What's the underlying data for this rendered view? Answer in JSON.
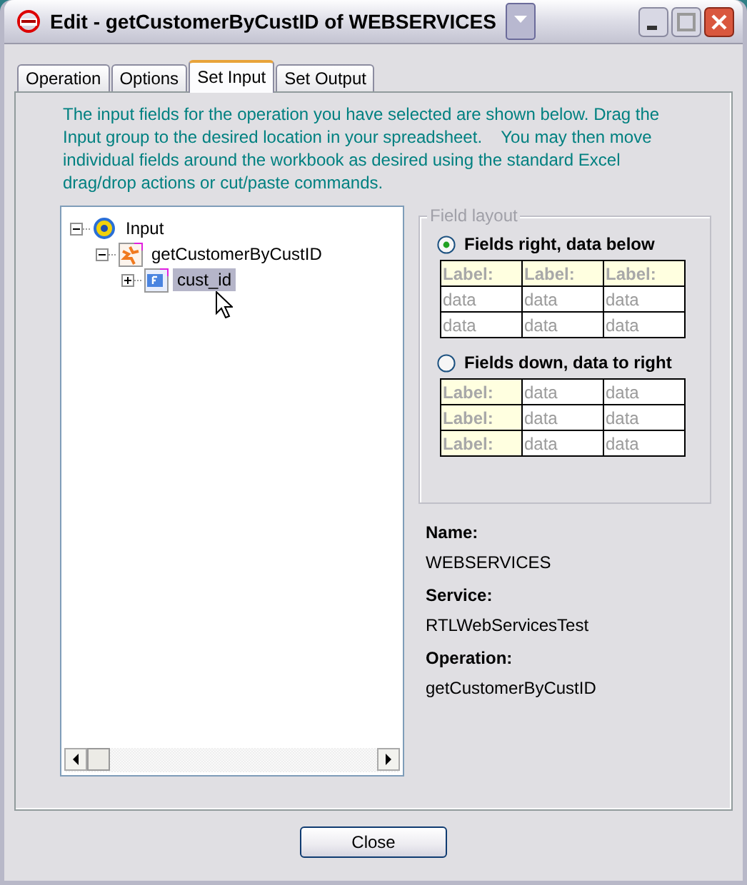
{
  "window": {
    "title": "Edit - getCustomerByCustID of WEBSERVICES"
  },
  "tabs": [
    {
      "label": "Operation",
      "selected": false
    },
    {
      "label": "Options",
      "selected": false
    },
    {
      "label": "Set Input",
      "selected": true
    },
    {
      "label": "Set Output",
      "selected": false
    }
  ],
  "description": "The input fields for the operation you have selected are shown below. Drag the Input group to the desired location in your spreadsheet.    You may then move individual fields around the workbook as desired using the standard Excel drag/drop actions or cut/paste commands.",
  "tree": [
    {
      "label": "Input",
      "kind": "input",
      "expanded": true,
      "selected": false,
      "children": [
        {
          "label": "getCustomerByCustID",
          "kind": "operation",
          "expanded": true,
          "selected": false,
          "children": [
            {
              "label": "cust_id",
              "kind": "field",
              "expanded": false,
              "selected": true
            }
          ]
        }
      ]
    }
  ],
  "field_layout": {
    "title": "Field layout",
    "options": [
      {
        "label": "Fields right, data below",
        "kind": "rows",
        "selected": true,
        "grid": [
          [
            "Label:",
            "Label:",
            "Label:"
          ],
          [
            "data",
            "data",
            "data"
          ],
          [
            "data",
            "data",
            "data"
          ]
        ]
      },
      {
        "label": "Fields down, data to right",
        "kind": "columns",
        "selected": false,
        "grid": [
          [
            "Label:",
            "data",
            "data"
          ],
          [
            "Label:",
            "data",
            "data"
          ],
          [
            "Label:",
            "data",
            "data"
          ]
        ]
      }
    ]
  },
  "info": [
    {
      "label": "Name:",
      "value": "WEBSERVICES"
    },
    {
      "label": "Service:",
      "value": "RTLWebServicesTest"
    },
    {
      "label": "Operation:",
      "value": "getCustomerByCustID"
    }
  ],
  "buttons": [
    {
      "label": "Close"
    }
  ]
}
